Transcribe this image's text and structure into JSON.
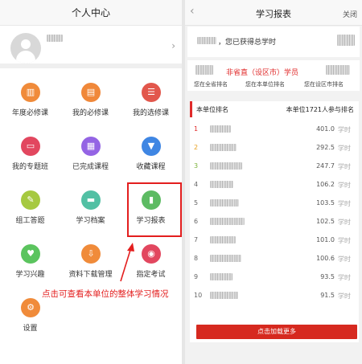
{
  "left": {
    "title": "个人中心",
    "menu": [
      {
        "label": "年度必修课",
        "icon": "books-icon",
        "color": "#f08b3a"
      },
      {
        "label": "我的必修课",
        "icon": "book-icon",
        "color": "#f0883a"
      },
      {
        "label": "我的选修课",
        "icon": "book-list-icon",
        "color": "#e2574c"
      },
      {
        "label": "我的专题班",
        "icon": "monitor-icon",
        "color": "#e2475f"
      },
      {
        "label": "已完成课程",
        "icon": "document-icon",
        "color": "#9464e4"
      },
      {
        "label": "收藏课程",
        "icon": "bookmark-icon",
        "color": "#3f86e3"
      },
      {
        "label": "组工答题",
        "icon": "quiz-icon",
        "color": "#a6c940"
      },
      {
        "label": "学习档案",
        "icon": "folder-icon",
        "color": "#52c0a4"
      },
      {
        "label": "学习报表",
        "icon": "chart-icon",
        "color": "#5dbb63"
      },
      {
        "label": "学习兴趣",
        "icon": "heart-icon",
        "color": "#5bc45e"
      },
      {
        "label": "资料下载管理",
        "icon": "download-icon",
        "color": "#f08b3a"
      },
      {
        "label": "指定考试",
        "icon": "compass-icon",
        "color": "#e2475f"
      },
      {
        "label": "设置",
        "icon": "gear-icon",
        "color": "#f08b3a"
      }
    ],
    "annotation": "点击可查看本单位的整体学习情况"
  },
  "right": {
    "title": "学习报表",
    "close": "关闭",
    "summary_text": "，您已获得总学时",
    "unit_name": "非省直（设区市）学员",
    "ranks": [
      "您在全省排名",
      "您在本单位排名",
      "您在设区市排名"
    ],
    "list_title": "本单位排名",
    "list_count": "本单位1721人参与排名",
    "unit": "学时",
    "rows": [
      {
        "rank": "1",
        "value": "401.0",
        "color": "#e02a2a"
      },
      {
        "rank": "2",
        "value": "292.5",
        "color": "#e8a020"
      },
      {
        "rank": "3",
        "value": "247.7",
        "color": "#7bb33a"
      },
      {
        "rank": "4",
        "value": "106.2",
        "color": "#666666"
      },
      {
        "rank": "5",
        "value": "103.5",
        "color": "#666666"
      },
      {
        "rank": "6",
        "value": "102.5",
        "color": "#666666"
      },
      {
        "rank": "7",
        "value": "101.0",
        "color": "#666666"
      },
      {
        "rank": "8",
        "value": "100.6",
        "color": "#666666"
      },
      {
        "rank": "9",
        "value": "93.5",
        "color": "#666666"
      },
      {
        "rank": "10",
        "value": "91.5",
        "color": "#666666"
      }
    ],
    "load_more": "点击加载更多"
  }
}
